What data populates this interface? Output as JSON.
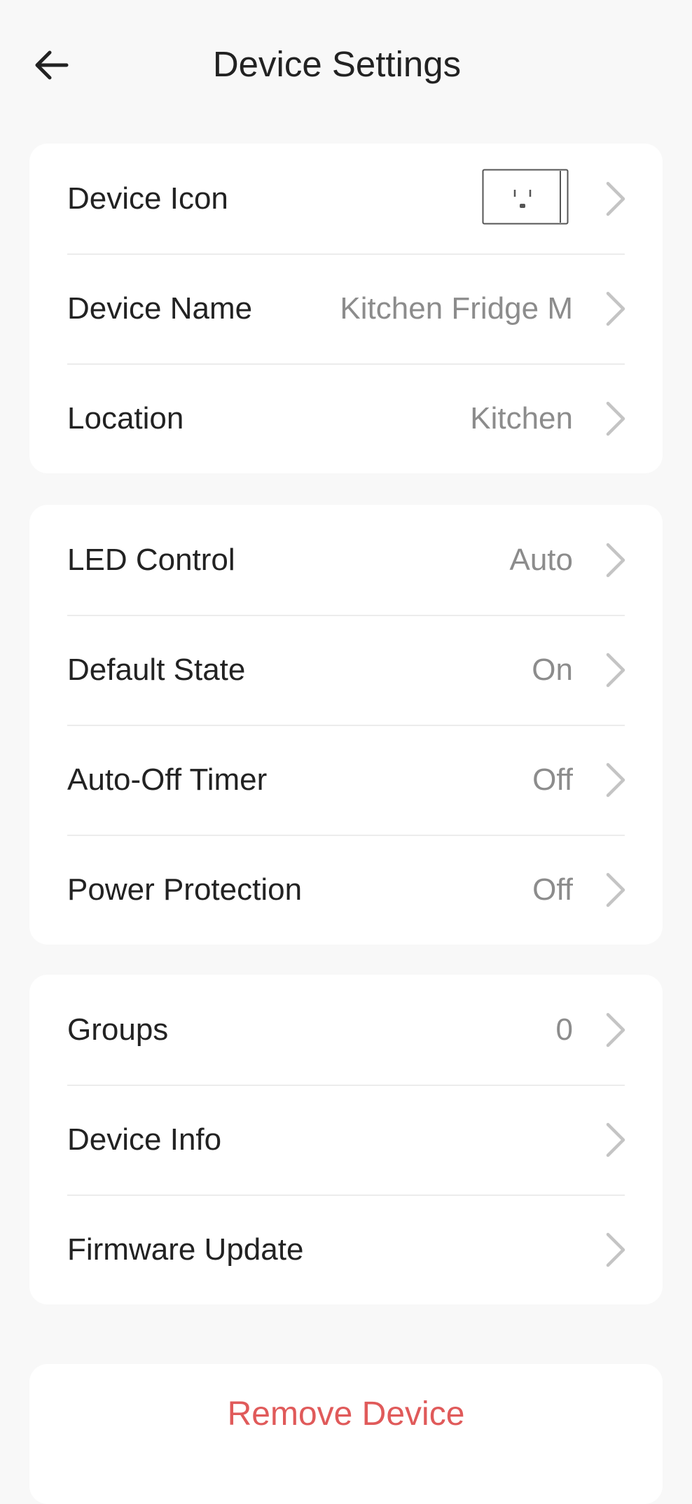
{
  "header": {
    "title": "Device Settings",
    "back_icon": "arrow-left-icon"
  },
  "sections": [
    {
      "rows": [
        {
          "label": "Device Icon",
          "value": "",
          "icon": "smart-plug-outlet-icon"
        },
        {
          "label": "Device Name",
          "value": "Kitchen Fridge M"
        },
        {
          "label": "Location",
          "value": "Kitchen"
        }
      ]
    },
    {
      "rows": [
        {
          "label": "LED Control",
          "value": "Auto"
        },
        {
          "label": "Default State",
          "value": "On"
        },
        {
          "label": "Auto-Off Timer",
          "value": "Off"
        },
        {
          "label": "Power Protection",
          "value": "Off"
        }
      ]
    },
    {
      "rows": [
        {
          "label": "Groups",
          "value": "0"
        },
        {
          "label": "Device Info",
          "value": ""
        },
        {
          "label": "Firmware Update",
          "value": ""
        }
      ]
    }
  ],
  "remove_button": {
    "label": "Remove Device",
    "color": "#e05a5a"
  },
  "colors": {
    "background": "#f8f8f8",
    "card": "#ffffff",
    "value_text": "#8c8c8c",
    "chevron": "#c4c4c4"
  }
}
